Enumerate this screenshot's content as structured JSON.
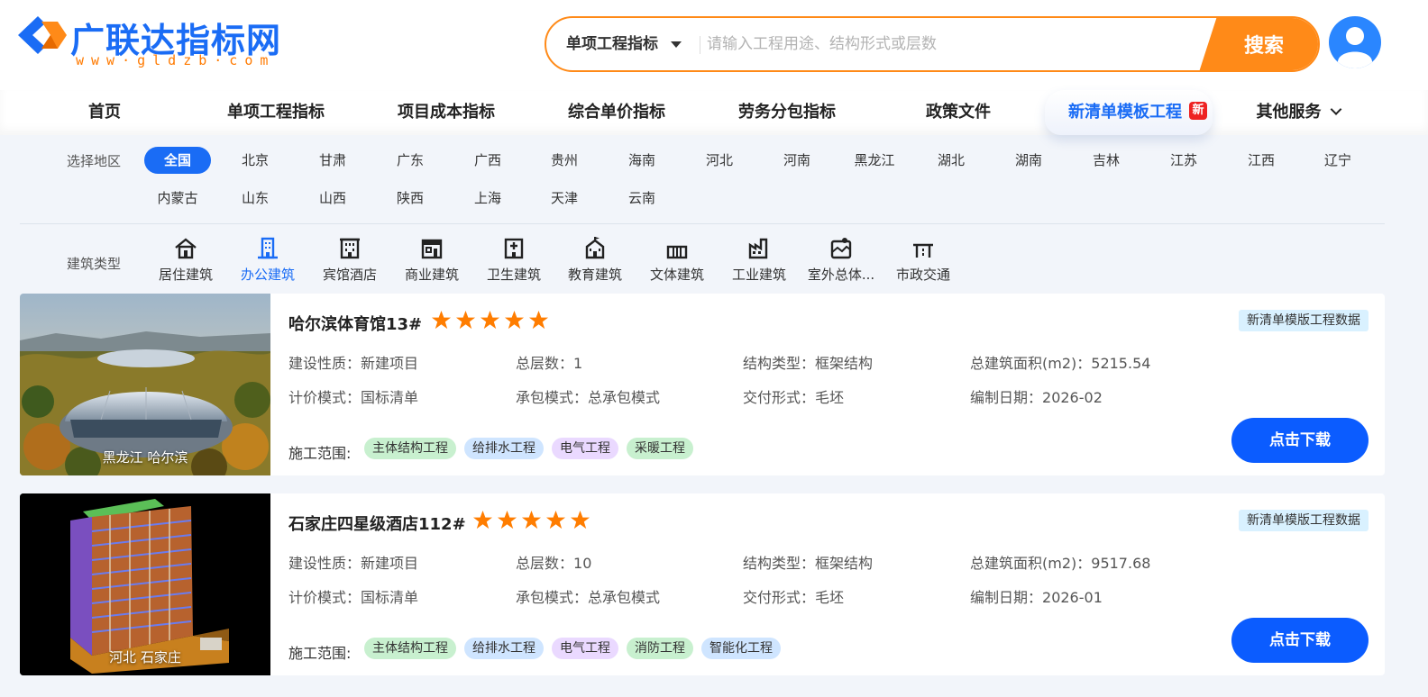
{
  "logo": {
    "title": "广联达指标网",
    "subtitle": "www·gldzb·com"
  },
  "search": {
    "category": "单项工程指标",
    "placeholder": "请输入工程用途、结构形式或层数",
    "button": "搜索"
  },
  "nav": {
    "items": [
      "首页",
      "单项工程指标",
      "项目成本指标",
      "综合单价指标",
      "劳务分包指标",
      "政策文件"
    ],
    "highlight": "新清单模板工程",
    "new_badge": "新",
    "more": "其他服务"
  },
  "filters": {
    "region_label": "选择地区",
    "regions_row1": [
      "全国",
      "北京",
      "甘肃",
      "广东",
      "广西",
      "贵州",
      "海南",
      "河北",
      "河南",
      "黑龙江",
      "湖北",
      "湖南",
      "吉林",
      "江苏",
      "江西",
      "辽宁"
    ],
    "regions_row2": [
      "内蒙古",
      "山东",
      "山西",
      "陕西",
      "上海",
      "天津",
      "云南"
    ],
    "active_region": "全国",
    "type_label": "建筑类型",
    "types": [
      {
        "label": "居住建筑",
        "icon": "house-icon"
      },
      {
        "label": "办公建筑",
        "icon": "office-building-icon"
      },
      {
        "label": "宾馆酒店",
        "icon": "hotel-icon"
      },
      {
        "label": "商业建筑",
        "icon": "shop-icon"
      },
      {
        "label": "卫生建筑",
        "icon": "hospital-icon"
      },
      {
        "label": "教育建筑",
        "icon": "school-icon"
      },
      {
        "label": "文体建筑",
        "icon": "stadium-icon"
      },
      {
        "label": "工业建筑",
        "icon": "factory-icon"
      },
      {
        "label": "室外总体...",
        "icon": "outdoor-icon"
      },
      {
        "label": "市政交通",
        "icon": "bridge-icon"
      }
    ],
    "active_type": "办公建筑"
  },
  "cards": [
    {
      "title": "哈尔滨体育馆13#",
      "rating": 5,
      "tag": "新清单模版工程数据",
      "location": "黑龙江 哈尔滨",
      "fields": [
        {
          "label": "建设性质：",
          "value": "新建项目"
        },
        {
          "label": "总层数：",
          "value": "1"
        },
        {
          "label": "结构类型：",
          "value": "框架结构"
        },
        {
          "label": "总建筑面积(m2)：",
          "value": "5215.54"
        },
        {
          "label": "计价模式：",
          "value": "国标清单"
        },
        {
          "label": "承包模式：",
          "value": "总承包模式"
        },
        {
          "label": "交付形式：",
          "value": "毛坯"
        },
        {
          "label": "编制日期：",
          "value": "2026-02"
        }
      ],
      "scope_label": "施工范围:",
      "scope": [
        "主体结构工程",
        "给排水工程",
        "电气工程",
        "采暖工程"
      ],
      "download": "点击下载"
    },
    {
      "title": "石家庄四星级酒店112#",
      "rating": 5,
      "tag": "新清单模版工程数据",
      "location": "河北 石家庄",
      "fields": [
        {
          "label": "建设性质：",
          "value": "新建项目"
        },
        {
          "label": "总层数：",
          "value": "10"
        },
        {
          "label": "结构类型：",
          "value": "框架结构"
        },
        {
          "label": "总建筑面积(m2)：",
          "value": "9517.68"
        },
        {
          "label": "计价模式：",
          "value": "国标清单"
        },
        {
          "label": "承包模式：",
          "value": "总承包模式"
        },
        {
          "label": "交付形式：",
          "value": "毛坯"
        },
        {
          "label": "编制日期：",
          "value": "2026-01"
        }
      ],
      "scope_label": "施工范围:",
      "scope": [
        "主体结构工程",
        "给排水工程",
        "电气工程",
        "消防工程",
        "智能化工程"
      ],
      "download": "点击下载"
    }
  ],
  "colors": {
    "brand_blue": "#1a6cf5",
    "accent_orange": "#ff8a18",
    "star": "#ff7d00"
  }
}
